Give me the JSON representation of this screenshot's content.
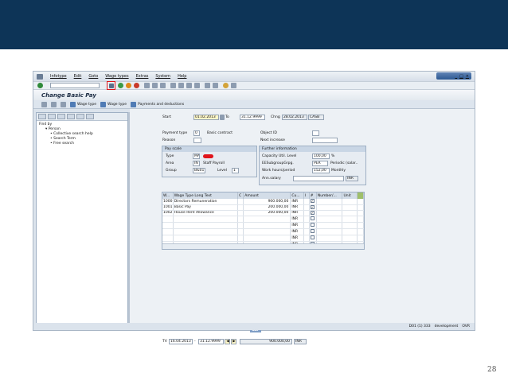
{
  "menu": {
    "items": [
      "Infotype",
      "Edit",
      "Goto",
      "Wage types",
      "Extras",
      "System",
      "Help"
    ]
  },
  "title": "Change Basic Pay",
  "app_toolbar": {
    "wage_type_1": "Wage type",
    "wage_type_2": "Wage type",
    "payments": "Payments and deductions"
  },
  "nav": {
    "find_by": "Find by",
    "person": "Person",
    "items": [
      "Collective search help",
      "Search Term",
      "Free search"
    ]
  },
  "header": {
    "start_label": "Start",
    "start_value": "01.02.2013",
    "to_label": "To",
    "to_value": "31.12.9999",
    "chng_label": "Chng",
    "chng_value": "28.02.2013",
    "chng_user": "CASB",
    "payment_type_label": "Payment type",
    "payment_type_value": "0",
    "payment_type_text": "Basic contract",
    "reason_label": "Reason",
    "object_id_label": "Object ID",
    "next_increase_label": "Next increase"
  },
  "pay_scale": {
    "title": "Pay scale",
    "type_label": "Type",
    "type_value": "MA",
    "area_label": "Area",
    "area_value": "IN",
    "area_text": "Staff Payroll",
    "group_label": "Group",
    "group_value": "B&01",
    "level_label": "Level",
    "level_value": "1"
  },
  "further": {
    "title": "Further information",
    "cap_label": "Capacity Util. Level",
    "cap_value": "100,00",
    "cap_unit": "%",
    "eesg_label": "EESubgroupGrpg.",
    "eesg_value": "PER",
    "eesg_text": "Periodic (salar..",
    "hours_label": "Work hours/period",
    "hours_value": "152,00",
    "hours_unit": "Monthly",
    "ann_label": "Ann.salary",
    "ann_currency": "INR"
  },
  "table": {
    "columns": [
      "W...",
      "Wage Type Long Text",
      "C",
      "Amount",
      "Cu...",
      "I",
      "#",
      "Number/...",
      "Unit"
    ],
    "rows": [
      {
        "code": "1000",
        "text": "Directors Remuneration",
        "amount": "900.000,00",
        "cur": "INR",
        "checked": true
      },
      {
        "code": "1001",
        "text": "Basic Pay",
        "amount": "200.000,00",
        "cur": "INR",
        "checked": true
      },
      {
        "code": "1002",
        "text": "House Rent Allowance",
        "amount": "200.000,00",
        "cur": "INR",
        "checked": true
      },
      {
        "code": "",
        "text": "",
        "amount": "",
        "cur": "INR",
        "checked": false
      },
      {
        "code": "",
        "text": "",
        "amount": "",
        "cur": "INR",
        "checked": false
      },
      {
        "code": "",
        "text": "",
        "amount": "",
        "cur": "INR",
        "checked": false
      },
      {
        "code": "",
        "text": "",
        "amount": "",
        "cur": "INR",
        "checked": false
      },
      {
        "code": "",
        "text": "",
        "amount": "",
        "cur": "INR",
        "checked": false
      }
    ]
  },
  "footer": {
    "tv_label": "TV",
    "from": "16.04.2013",
    "dash": "-",
    "to": "31.12.9999",
    "total": "900.000,00",
    "currency": "INR"
  },
  "status": {
    "system": "D01 (1) 333",
    "env": "development",
    "mode": "OVR"
  },
  "page_number": "28",
  "colors": {
    "band": "#0d3457",
    "highlight": "#e0141b"
  }
}
